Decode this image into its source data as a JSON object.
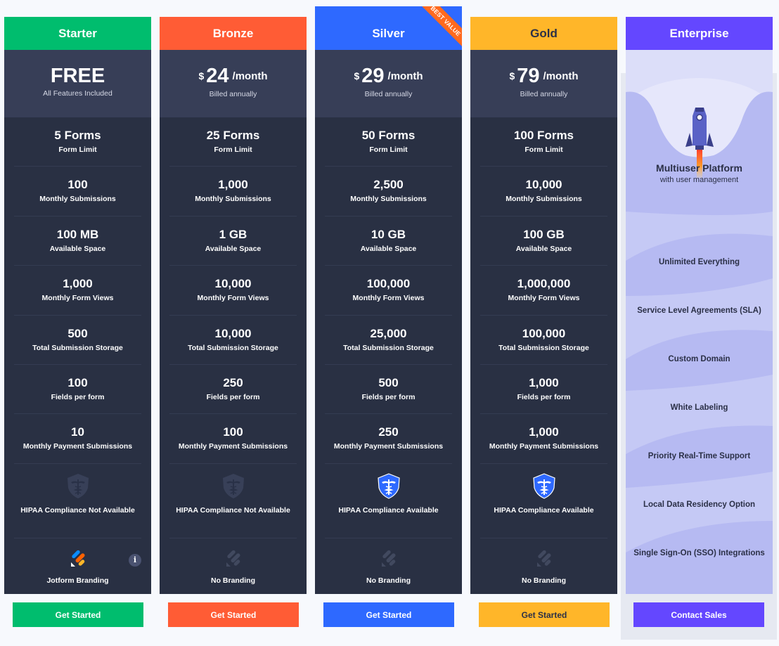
{
  "plans": [
    {
      "name": "Starter",
      "color": "#00bd6e",
      "text_color": "#ffffff",
      "price_main": "FREE",
      "price_symbol": "",
      "price_period": "",
      "price_sub": "All Features Included",
      "features": [
        {
          "value": "5 Forms",
          "label": "Form Limit"
        },
        {
          "value": "100",
          "label": "Monthly Submissions"
        },
        {
          "value": "100 MB",
          "label": "Available Space"
        },
        {
          "value": "1,000",
          "label": "Monthly Form Views"
        },
        {
          "value": "500",
          "label": "Total Submission Storage"
        },
        {
          "value": "100",
          "label": "Fields per form"
        },
        {
          "value": "10",
          "label": "Monthly Payment Submissions"
        }
      ],
      "hipaa": {
        "available": false,
        "label": "HIPAA Compliance Not Available"
      },
      "branding": {
        "active": true,
        "label": "Jotform Branding",
        "info": "i"
      },
      "button": "Get Started"
    },
    {
      "name": "Bronze",
      "color": "#ff5c35",
      "text_color": "#ffffff",
      "price_main": "24",
      "price_symbol": "$",
      "price_period": "/month",
      "price_sub": "Billed annually",
      "features": [
        {
          "value": "25 Forms",
          "label": "Form Limit"
        },
        {
          "value": "1,000",
          "label": "Monthly Submissions"
        },
        {
          "value": "1 GB",
          "label": "Available Space"
        },
        {
          "value": "10,000",
          "label": "Monthly Form Views"
        },
        {
          "value": "10,000",
          "label": "Total Submission Storage"
        },
        {
          "value": "250",
          "label": "Fields per form"
        },
        {
          "value": "100",
          "label": "Monthly Payment Submissions"
        }
      ],
      "hipaa": {
        "available": false,
        "label": "HIPAA Compliance Not Available"
      },
      "branding": {
        "active": false,
        "label": "No Branding"
      },
      "button": "Get Started"
    },
    {
      "name": "Silver",
      "color": "#2e69ff",
      "text_color": "#ffffff",
      "badge": "BEST VALUE",
      "price_main": "29",
      "price_symbol": "$",
      "price_period": "/month",
      "price_sub": "Billed annually",
      "features": [
        {
          "value": "50 Forms",
          "label": "Form Limit"
        },
        {
          "value": "2,500",
          "label": "Monthly Submissions"
        },
        {
          "value": "10 GB",
          "label": "Available Space"
        },
        {
          "value": "100,000",
          "label": "Monthly Form Views"
        },
        {
          "value": "25,000",
          "label": "Total Submission Storage"
        },
        {
          "value": "500",
          "label": "Fields per form"
        },
        {
          "value": "250",
          "label": "Monthly Payment Submissions"
        }
      ],
      "hipaa": {
        "available": true,
        "label": "HIPAA Compliance Available"
      },
      "branding": {
        "active": false,
        "label": "No Branding"
      },
      "button": "Get Started"
    },
    {
      "name": "Gold",
      "color": "#ffb629",
      "text_color": "#2b3047",
      "price_main": "79",
      "price_symbol": "$",
      "price_period": "/month",
      "price_sub": "Billed annually",
      "features": [
        {
          "value": "100 Forms",
          "label": "Form Limit"
        },
        {
          "value": "10,000",
          "label": "Monthly Submissions"
        },
        {
          "value": "100 GB",
          "label": "Available Space"
        },
        {
          "value": "1,000,000",
          "label": "Monthly Form Views"
        },
        {
          "value": "100,000",
          "label": "Total Submission Storage"
        },
        {
          "value": "1,000",
          "label": "Fields per form"
        },
        {
          "value": "1,000",
          "label": "Monthly Payment Submissions"
        }
      ],
      "hipaa": {
        "available": true,
        "label": "HIPAA Compliance Available"
      },
      "branding": {
        "active": false,
        "label": "No Branding"
      },
      "button": "Get Started"
    }
  ],
  "enterprise": {
    "name": "Enterprise",
    "color": "#6447ff",
    "headline": "Multiuser Platform",
    "subline": "with user management",
    "features": [
      "Unlimited Everything",
      "Service Level Agreements (SLA)",
      "Custom Domain",
      "White Labeling",
      "Priority Real-Time Support",
      "Local Data Residency Option",
      "Single Sign-On (SSO) Integrations"
    ],
    "button": "Contact Sales"
  }
}
